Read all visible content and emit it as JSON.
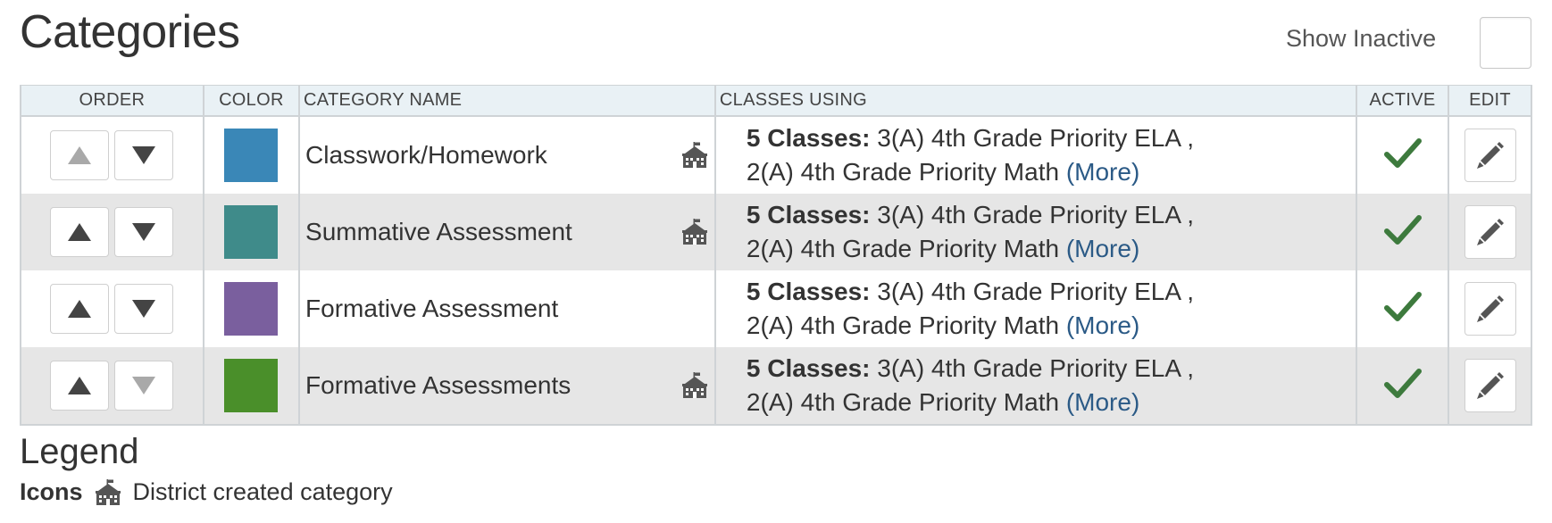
{
  "page": {
    "title": "Categories"
  },
  "show_inactive": {
    "label": "Show Inactive",
    "checked": false
  },
  "table": {
    "headers": {
      "order": "ORDER",
      "color": "COLOR",
      "category_name": "CATEGORY NAME",
      "classes_using": "CLASSES USING",
      "active": "ACTIVE",
      "edit": "EDIT"
    },
    "rows": [
      {
        "name": "Classwork/Homework",
        "color": "#3a87b7",
        "district_created": true,
        "classes_count": "5 Classes:",
        "classes_line1": "3(A) 4th Grade Priority ELA ,",
        "classes_line2": "2(A) 4th Grade Priority Math",
        "more": "(More)",
        "active": true,
        "up_enabled": false,
        "down_enabled": true
      },
      {
        "name": "Summative Assessment",
        "color": "#3f8b8a",
        "district_created": true,
        "classes_count": "5 Classes:",
        "classes_line1": "3(A) 4th Grade Priority ELA ,",
        "classes_line2": "2(A) 4th Grade Priority Math",
        "more": "(More)",
        "active": true,
        "up_enabled": true,
        "down_enabled": true
      },
      {
        "name": "Formative Assessment",
        "color": "#7a5f9e",
        "district_created": false,
        "classes_count": "5 Classes:",
        "classes_line1": "3(A) 4th Grade Priority ELA ,",
        "classes_line2": "2(A) 4th Grade Priority Math",
        "more": "(More)",
        "active": true,
        "up_enabled": true,
        "down_enabled": true
      },
      {
        "name": "Formative Assessments",
        "color": "#4a8f2a",
        "district_created": true,
        "classes_count": "5 Classes:",
        "classes_line1": "3(A) 4th Grade Priority ELA ,",
        "classes_line2": "2(A) 4th Grade Priority Math",
        "more": "(More)",
        "active": true,
        "up_enabled": true,
        "down_enabled": false
      }
    ]
  },
  "legend": {
    "title": "Legend",
    "icons_label": "Icons",
    "district_icon": "school-building-icon",
    "district_text": "District created category"
  },
  "colors": {
    "check": "#3d7a3d",
    "link": "#2b5a86",
    "header_bg": "#e9f1f5",
    "row_alt_bg": "#e6e6e6"
  }
}
